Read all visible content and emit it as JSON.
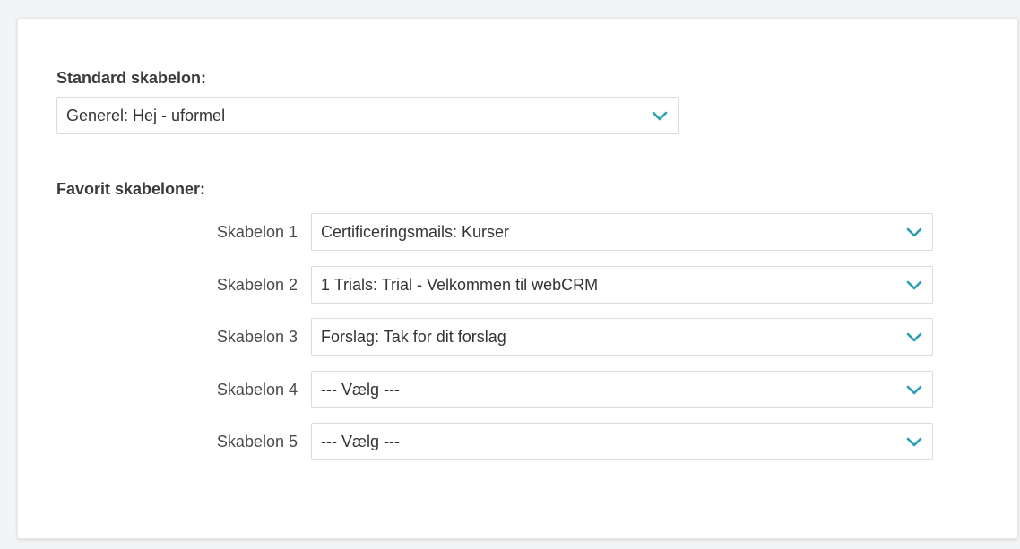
{
  "standard": {
    "label": "Standard skabelon:",
    "value": "Generel: Hej - uformel"
  },
  "favorites": {
    "label": "Favorit skabeloner:",
    "rows": [
      {
        "label": "Skabelon 1",
        "value": "Certificeringsmails: Kurser"
      },
      {
        "label": "Skabelon 2",
        "value": "1 Trials: Trial - Velkommen til webCRM"
      },
      {
        "label": "Skabelon 3",
        "value": "Forslag: Tak for dit forslag"
      },
      {
        "label": "Skabelon 4",
        "value": "--- Vælg ---"
      },
      {
        "label": "Skabelon 5",
        "value": "--- Vælg ---"
      }
    ]
  },
  "icons": {
    "dropdown": "chevron-down-icon"
  },
  "colors": {
    "accent": "#2a9fb0",
    "border": "#d9dcdf",
    "card": "#ffffff",
    "page": "#f3f4f5"
  }
}
